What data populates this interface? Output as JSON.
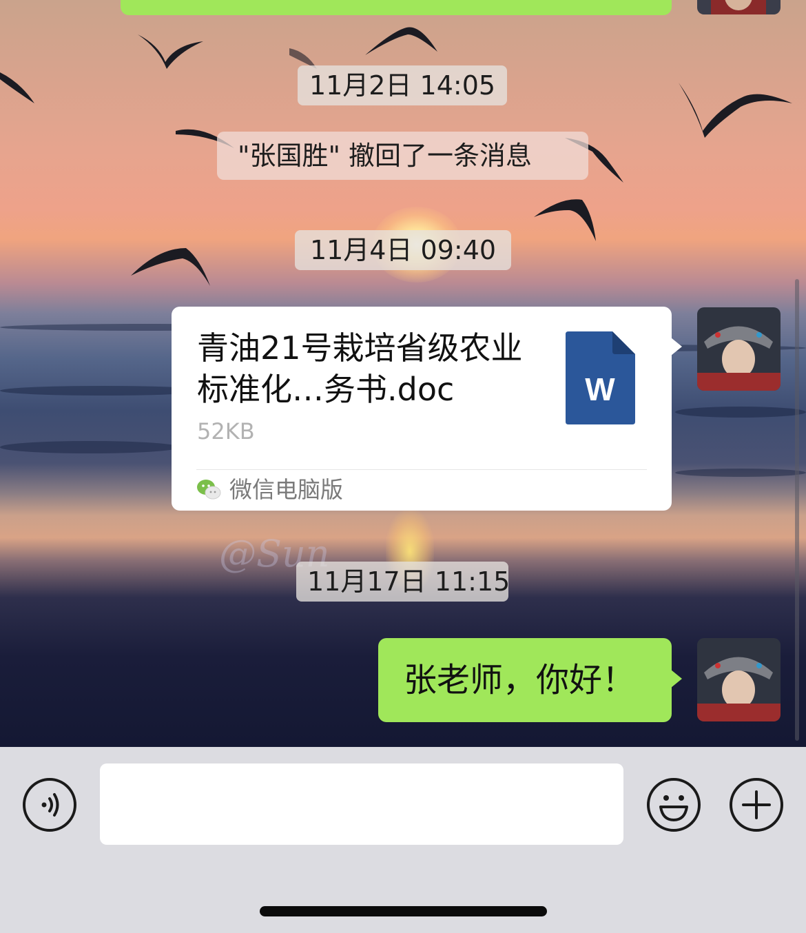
{
  "conversation": {
    "messages": [
      {
        "type": "timestamp",
        "text": "11月2日 14:05"
      },
      {
        "type": "system",
        "text": "\"张国胜\" 撤回了一条消息"
      },
      {
        "type": "timestamp",
        "text": "11月4日 09:40"
      },
      {
        "type": "file",
        "sender": "self",
        "file_name": "青油21号栽培省级农业标准化…务书.doc",
        "file_size": "52KB",
        "file_icon_letter": "W",
        "source": "微信电脑版"
      },
      {
        "type": "timestamp",
        "text": "11月17日 11:15"
      },
      {
        "type": "text",
        "sender": "self",
        "text": "张老师，你好！"
      }
    ]
  },
  "background": {
    "watermark": "@Sun"
  },
  "input_bar": {
    "voice_icon": "voice-icon",
    "emoji_icon": "emoji-icon",
    "plus_icon": "plus-icon",
    "message_value": ""
  },
  "colors": {
    "bubble_green": "#a0e75a",
    "word_blue": "#2b579a",
    "input_bar_bg": "#dcdce1"
  }
}
